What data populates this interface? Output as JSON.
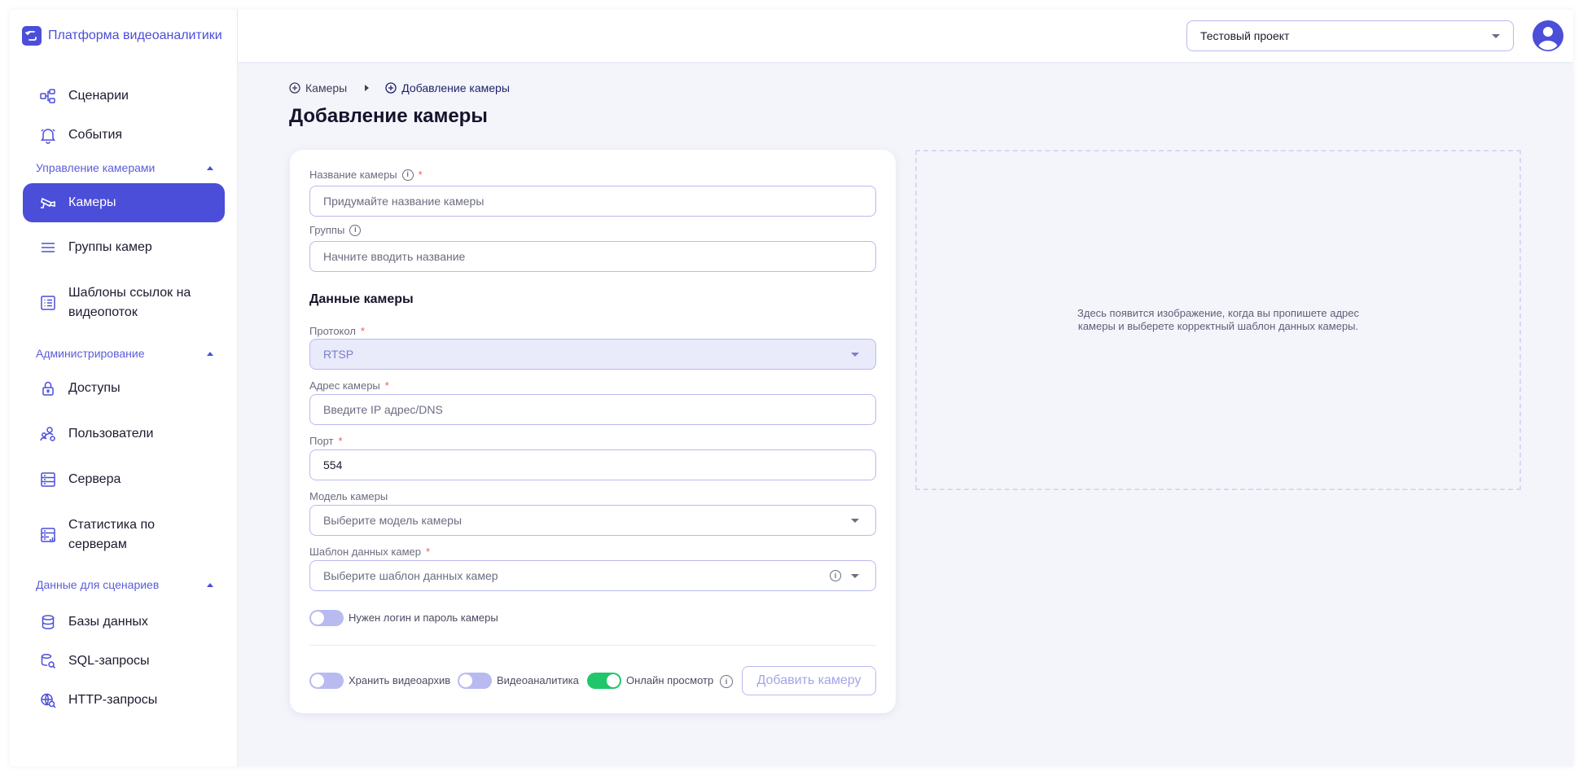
{
  "brand": {
    "title": "Платформа видеоаналитики"
  },
  "sidebar": {
    "items_top": [
      {
        "label": "Сценарии",
        "icon": "scenario-icon"
      },
      {
        "label": "События",
        "icon": "bell-icon"
      }
    ],
    "sections": [
      {
        "title": "Управление камерами",
        "items": [
          {
            "label": "Камеры",
            "icon": "camera-icon",
            "active": true
          },
          {
            "label": "Группы камер",
            "icon": "list-icon"
          },
          {
            "label": "Шаблоны ссылок на видеопоток",
            "icon": "template-icon"
          }
        ]
      },
      {
        "title": "Администрирование",
        "items": [
          {
            "label": "Доступы",
            "icon": "lock-icon"
          },
          {
            "label": "Пользователи",
            "icon": "users-icon"
          },
          {
            "label": "Сервера",
            "icon": "server-icon"
          },
          {
            "label": "Статистика по серверам",
            "icon": "server-stats-icon"
          }
        ]
      },
      {
        "title": "Данные для сценариев",
        "items": [
          {
            "label": "Базы данных",
            "icon": "database-icon"
          },
          {
            "label": "SQL-запросы",
            "icon": "sql-query-icon"
          },
          {
            "label": "HTTP-запросы",
            "icon": "http-query-icon"
          }
        ]
      }
    ]
  },
  "header": {
    "project": "Тестовый проект"
  },
  "breadcrumb": [
    "Камеры",
    "Добавление камеры"
  ],
  "page_title": "Добавление камеры",
  "form": {
    "name": {
      "label": "Название камеры",
      "placeholder": "Придумайте название камеры"
    },
    "groups": {
      "label": "Группы",
      "placeholder": "Начните вводить название"
    },
    "section_title": "Данные камеры",
    "protocol": {
      "label": "Протокол",
      "value": "RTSP"
    },
    "address": {
      "label": "Адрес камеры",
      "placeholder": "Введите IP адрес/DNS"
    },
    "port": {
      "label": "Порт",
      "value": "554"
    },
    "model": {
      "label": "Модель камеры",
      "placeholder": "Выберите модель камеры"
    },
    "template": {
      "label": "Шаблон данных камер",
      "placeholder": "Выберите шаблон данных камер"
    },
    "login_toggle": {
      "label": "Нужен логин и пароль камеры",
      "on": false
    },
    "archive_toggle": {
      "label": "Хранить видеоархив",
      "on": false
    },
    "analytics_toggle": {
      "label": "Видеоаналитика",
      "on": false
    },
    "online_toggle": {
      "label": "Онлайн просмотр",
      "on": true
    },
    "submit": "Добавить камеру"
  },
  "preview": {
    "text": "Здесь появится изображение, когда вы пропишете адрес камеры и выберете корректный шаблон данных камеры."
  },
  "colors": {
    "accent": "#4b4ed8",
    "toggle_on": "#1fc66b",
    "required": "#f05a5a"
  }
}
